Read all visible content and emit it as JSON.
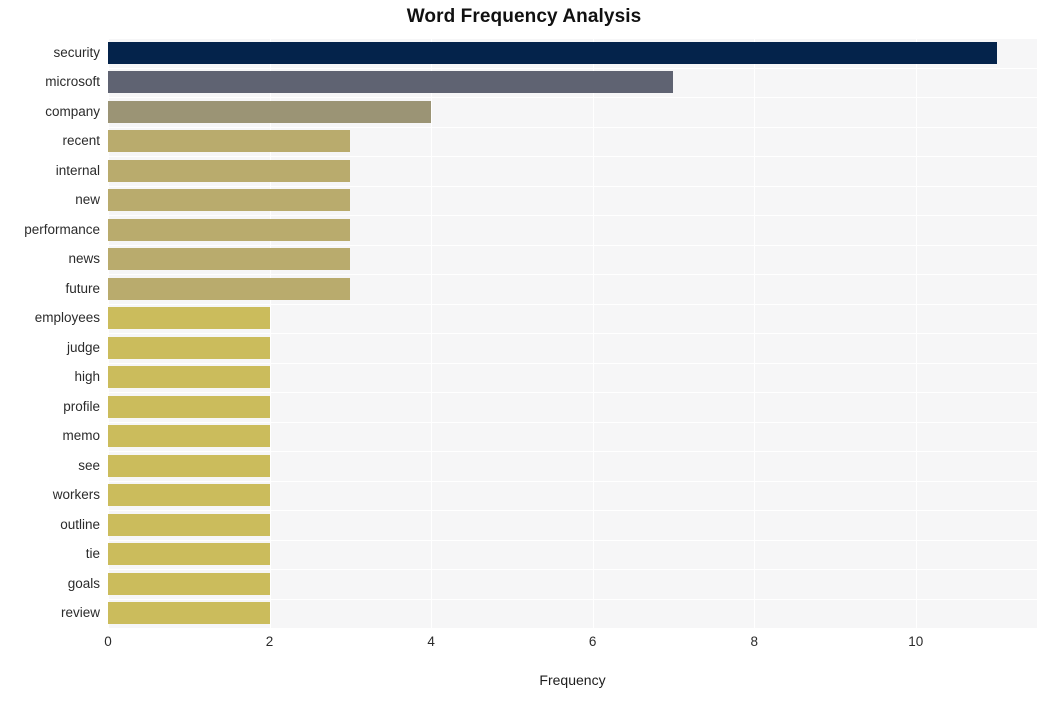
{
  "chart_data": {
    "type": "bar",
    "orientation": "horizontal",
    "title": "Word Frequency Analysis",
    "xlabel": "Frequency",
    "ylabel": "",
    "xlim": [
      0,
      11.5
    ],
    "xticks": [
      0,
      2,
      4,
      6,
      8,
      10
    ],
    "xtick_labels": [
      "0",
      "2",
      "4",
      "6",
      "8",
      "10"
    ],
    "grid": true,
    "legend": "none",
    "categories": [
      "security",
      "microsoft",
      "company",
      "recent",
      "internal",
      "new",
      "performance",
      "news",
      "future",
      "employees",
      "judge",
      "high",
      "profile",
      "memo",
      "see",
      "workers",
      "outline",
      "tie",
      "goals",
      "review"
    ],
    "values": [
      11,
      7,
      4,
      3,
      3,
      3,
      3,
      3,
      3,
      2,
      2,
      2,
      2,
      2,
      2,
      2,
      2,
      2,
      2,
      2
    ],
    "bar_colors": [
      "#04234b",
      "#5f6372",
      "#9b9475",
      "#b9ab6d",
      "#b9ab6d",
      "#b9ab6d",
      "#b9ab6d",
      "#b9ab6d",
      "#b9ab6d",
      "#cbbc5c",
      "#cbbc5c",
      "#cbbc5c",
      "#cbbc5c",
      "#cbbc5c",
      "#cbbc5c",
      "#cbbc5c",
      "#cbbc5c",
      "#cbbc5c",
      "#cbbc5c",
      "#cbbc5c"
    ]
  },
  "style": {
    "plot_background": "#f6f6f7",
    "gridline_color": "#ffffff",
    "page_background": "#ffffff",
    "text_color": "#2b2b2b",
    "title_color": "#111111"
  }
}
